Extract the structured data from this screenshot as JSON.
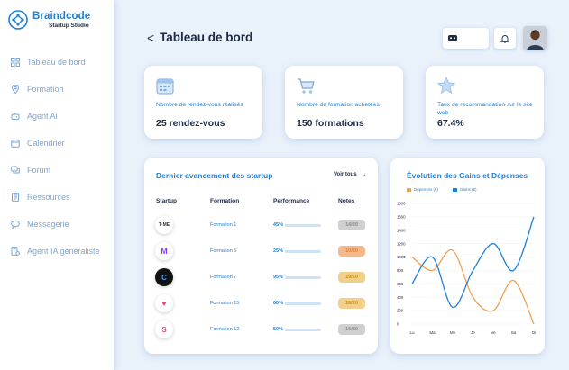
{
  "brand": {
    "name": "Braindcode",
    "subtitle": "Startup Studio"
  },
  "sidebar": {
    "items": [
      {
        "label": "Tableau de bord",
        "icon": "grid-icon"
      },
      {
        "label": "Formation",
        "icon": "location-icon"
      },
      {
        "label": "Agent Ai",
        "icon": "robot-icon"
      },
      {
        "label": "Calendrier",
        "icon": "calendar-icon"
      },
      {
        "label": "Forum",
        "icon": "chat-icon"
      },
      {
        "label": "Ressources",
        "icon": "document-icon"
      },
      {
        "label": "Messagerie",
        "icon": "message-icon"
      },
      {
        "label": "Agent IA généraliste",
        "icon": "agent-document-icon"
      }
    ]
  },
  "header": {
    "back_label": "<",
    "title": "Tableau de bord"
  },
  "stats": [
    {
      "label": "Nombre de rendez-vous réalisés",
      "value": "25 rendez-vous",
      "icon": "calendar-icon"
    },
    {
      "label": "Nombre de formation achetées",
      "value": "150 formations",
      "icon": "cart-icon"
    },
    {
      "label": "Taux de recommandation sur le site web",
      "value": "67.4%",
      "icon": "star-icon"
    }
  ],
  "table": {
    "title": "Dernier avancement des startup",
    "see_all": "Voir tous",
    "see_all_arrow": "→",
    "headers": {
      "startup": "Startup",
      "formation": "Formation",
      "performance": "Performance",
      "notes": "Notes"
    },
    "rows": [
      {
        "logo": "T·ME",
        "formation": "Formation 1",
        "performance": "45%",
        "pct": 0.45,
        "note": "14/20",
        "note_bg": "#d0d0d0",
        "note_color": "#8a8a8a"
      },
      {
        "logo": "M",
        "formation": "Formation 5",
        "performance": "25%",
        "pct": 0.25,
        "note": "10/20",
        "note_bg": "#f5b98e",
        "note_color": "#e07a2f"
      },
      {
        "logo": "C",
        "formation": "Formation 7",
        "performance": "95%",
        "pct": 0.95,
        "note": "19/20",
        "note_bg": "#f1d08c",
        "note_color": "#c98f13"
      },
      {
        "logo": "♥",
        "formation": "Formation 15",
        "performance": "60%",
        "pct": 0.6,
        "note": "18/20",
        "note_bg": "#f1d08c",
        "note_color": "#c98f13"
      },
      {
        "logo": "S",
        "formation": "Formation 12",
        "performance": "50%",
        "pct": 0.5,
        "note": "15/20",
        "note_bg": "#d0d0d0",
        "note_color": "#8a8a8a"
      }
    ]
  },
  "chart_data": {
    "type": "line",
    "title": "Évolution des Gains et Dépenses",
    "categories": [
      "Lu",
      "Ma",
      "Me",
      "Je",
      "Ve",
      "Sa",
      "Di"
    ],
    "ylim": [
      0,
      1800
    ],
    "yticks": [
      0,
      200,
      400,
      600,
      800,
      1000,
      1200,
      1400,
      1600,
      1800
    ],
    "series": [
      {
        "name": "Dépenses (€)",
        "color": "#f0a050",
        "values": [
          1000,
          800,
          1100,
          400,
          200,
          650,
          0
        ]
      },
      {
        "name": "Gains (€)",
        "color": "#1f7fd6",
        "values": [
          600,
          1000,
          250,
          800,
          1200,
          800,
          1600
        ]
      }
    ],
    "legend": "top"
  }
}
